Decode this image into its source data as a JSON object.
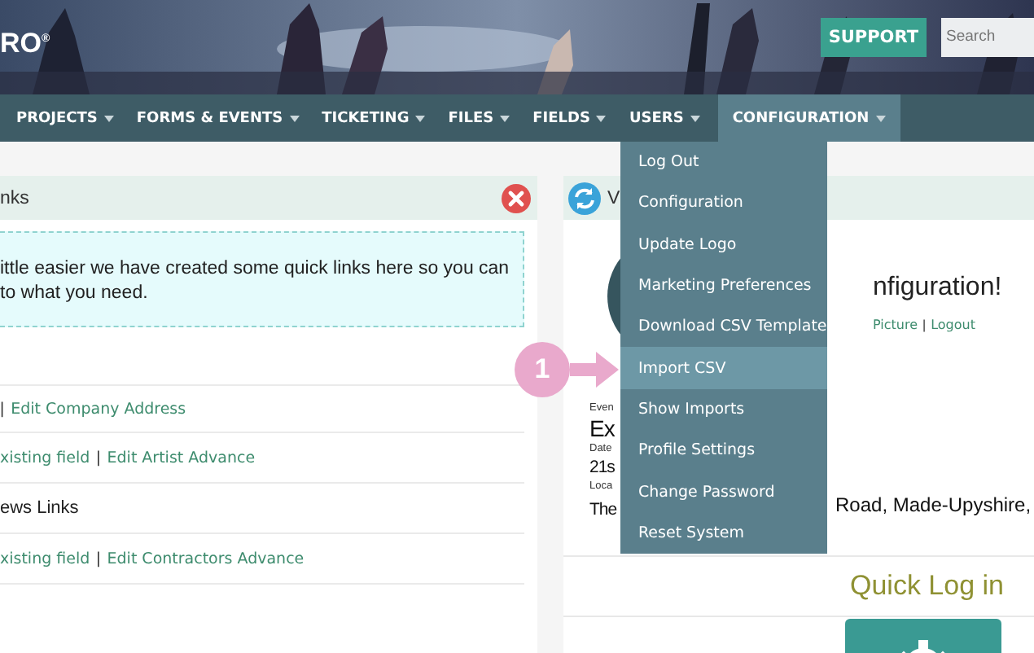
{
  "header": {
    "logo": "RO",
    "logo_mark": "®",
    "support_button": "SUPPORT",
    "search": {
      "placeholder": "Search"
    }
  },
  "nav": [
    {
      "label": "PROJECTS",
      "selected": false
    },
    {
      "label": "FORMS & EVENTS",
      "selected": false
    },
    {
      "label": "TICKETING",
      "selected": false
    },
    {
      "label": "FILES",
      "selected": false
    },
    {
      "label": "FIELDS",
      "selected": false
    },
    {
      "label": "USERS",
      "selected": false
    },
    {
      "label": "CONFIGURATION",
      "selected": true
    }
  ],
  "dropdown": [
    {
      "label": "Log Out",
      "selected": false
    },
    {
      "label": "Configuration",
      "selected": false
    },
    {
      "label": "Update Logo",
      "selected": false
    },
    {
      "label": "Marketing Preferences",
      "selected": false
    },
    {
      "label": "Download CSV Template",
      "selected": false
    },
    {
      "label": "Import CSV",
      "selected": true
    },
    {
      "label": "Show Imports",
      "selected": false
    },
    {
      "label": "Profile Settings",
      "selected": false
    },
    {
      "label": "Change Password",
      "selected": false
    },
    {
      "label": "Reset System",
      "selected": false
    }
  ],
  "callout": {
    "number": "1"
  },
  "quick_links_panel": {
    "title": "nks",
    "intro": "ittle easier we have created some quick links here so you can\nto what you need.",
    "rows": [
      {
        "parts": [
          {
            "kind": "sep",
            "text": "|"
          },
          {
            "kind": "link",
            "text": "Edit Company Address"
          }
        ]
      },
      {
        "parts": [
          {
            "kind": "link",
            "text": "xisting field"
          },
          {
            "kind": "sep",
            "text": "|"
          },
          {
            "kind": "link",
            "text": "Edit Artist Advance"
          }
        ]
      },
      {
        "parts": [
          {
            "kind": "plain",
            "text": "ews Links"
          }
        ]
      },
      {
        "parts": [
          {
            "kind": "link",
            "text": "xisting field"
          },
          {
            "kind": "sep",
            "text": "|"
          },
          {
            "kind": "link",
            "text": "Edit Contractors Advance"
          }
        ]
      }
    ]
  },
  "welcome_panel": {
    "title": "V",
    "greeting": "nfiguration!",
    "profile_links": [
      {
        "kind": "link",
        "text": "Picture"
      },
      {
        "kind": "sep",
        "text": "|"
      },
      {
        "kind": "link",
        "text": "Logout"
      }
    ],
    "event_label": "Even",
    "event_name": "Ex",
    "date_label": "Date",
    "date": "21s",
    "location_label": "Loca",
    "location_start": "The",
    "location_end": "Road, Made-Upyshire,",
    "quick_login_title": "Quick Log in"
  }
}
